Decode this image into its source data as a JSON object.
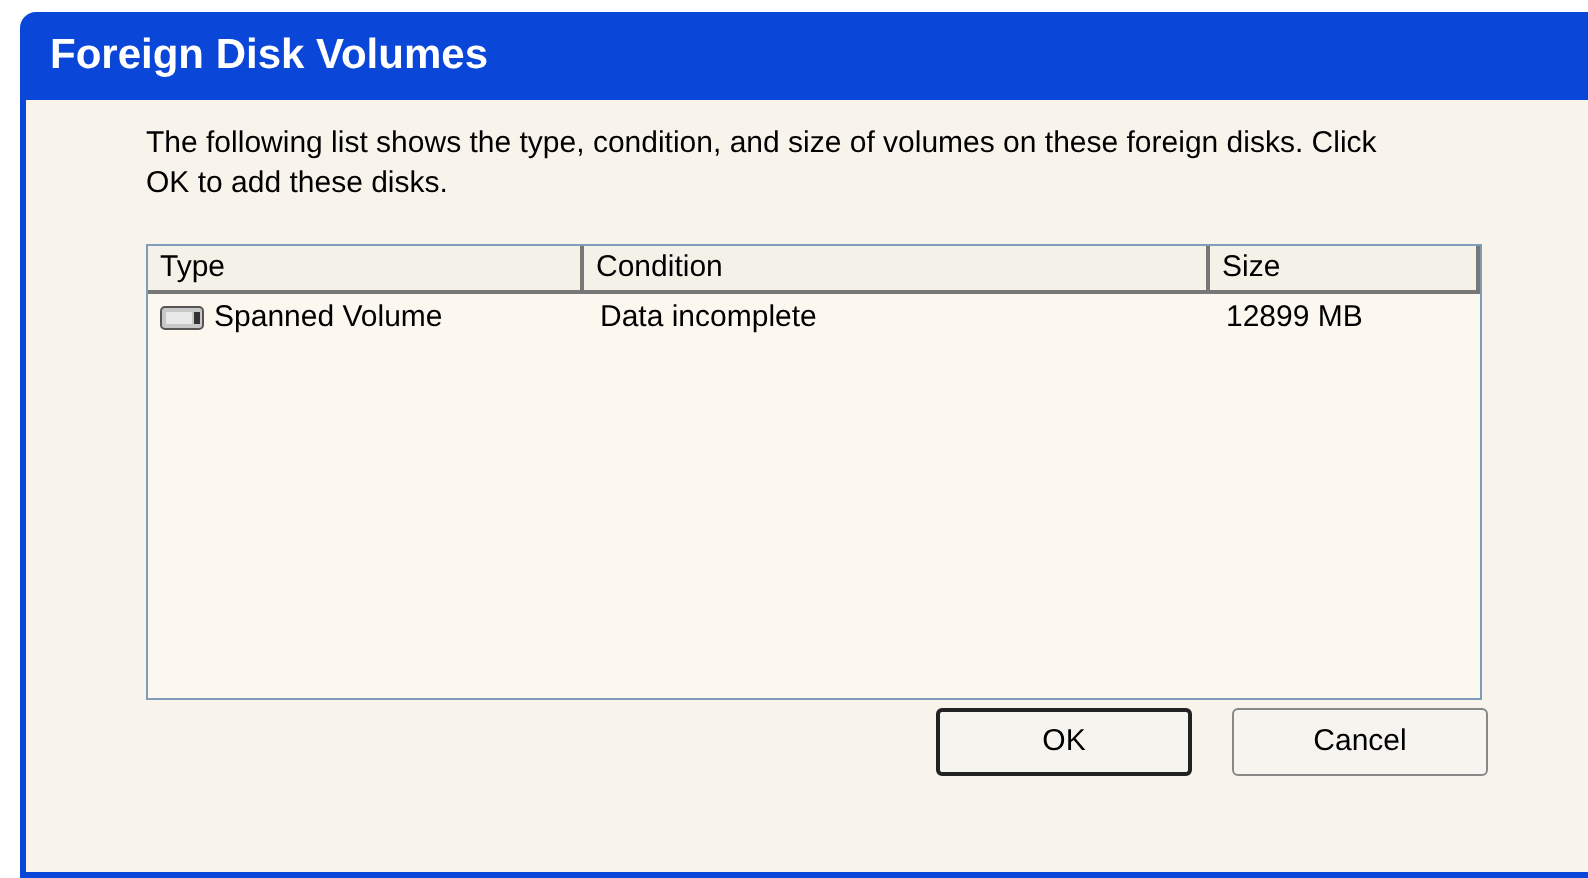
{
  "window": {
    "title": "Foreign Disk Volumes"
  },
  "description": "The following list shows the type, condition, and size of volumes on these foreign disks. Click OK to add these disks.",
  "table": {
    "columns": [
      "Type",
      "Condition",
      "Size"
    ],
    "rows": [
      {
        "type": "Spanned Volume",
        "condition": "Data incomplete",
        "size": "12899 MB"
      }
    ]
  },
  "buttons": [
    {
      "label": "OK",
      "default": true
    },
    {
      "label": "Cancel",
      "default": false
    }
  ]
}
